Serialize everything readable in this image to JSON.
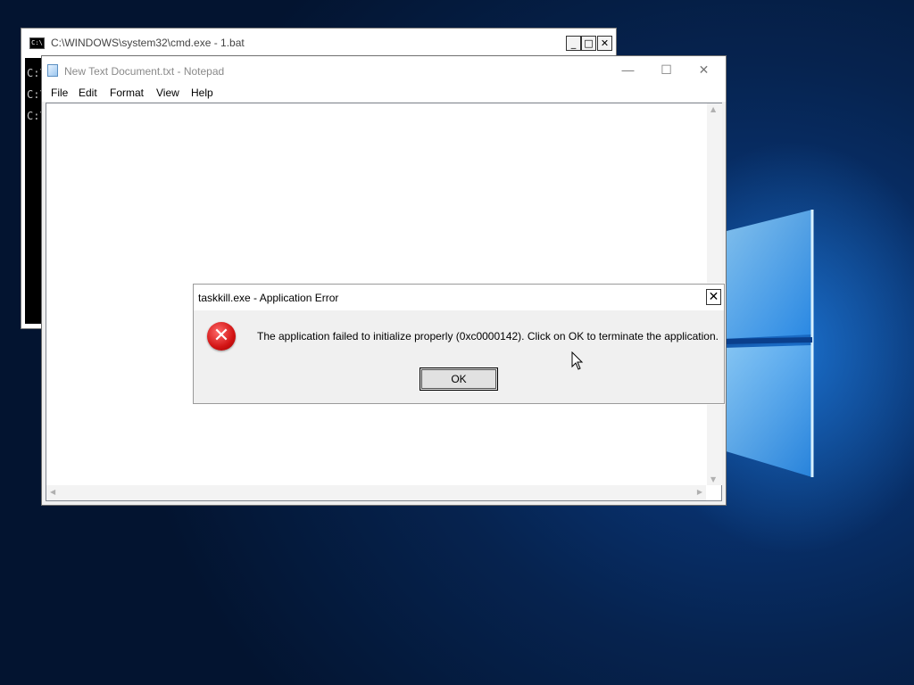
{
  "cmd_window": {
    "icon_text": "C:\\",
    "title": "C:\\WINDOWS\\system32\\cmd.exe - 1.bat",
    "lines": [
      "C:\\",
      "C:\\",
      "C:\\"
    ],
    "minimize": "_",
    "maximize": "□",
    "close": "✕"
  },
  "notepad": {
    "title": "New Text Document.txt - Notepad",
    "controls": {
      "minimize": "—",
      "maximize": "☐",
      "close": "✕"
    },
    "menu": [
      "File",
      "Edit",
      "Format",
      "View",
      "Help"
    ],
    "content": ""
  },
  "dialog": {
    "title": "taskkill.exe - Application Error",
    "close": "✕",
    "icon": "error-icon",
    "message": "The application failed to initialize properly (0xc0000142). Click on OK to terminate the application.",
    "ok_label": "OK"
  },
  "colors": {
    "desktop_bg": "#06234f",
    "logo": "#4fb3ff",
    "error_red": "#d21414"
  }
}
